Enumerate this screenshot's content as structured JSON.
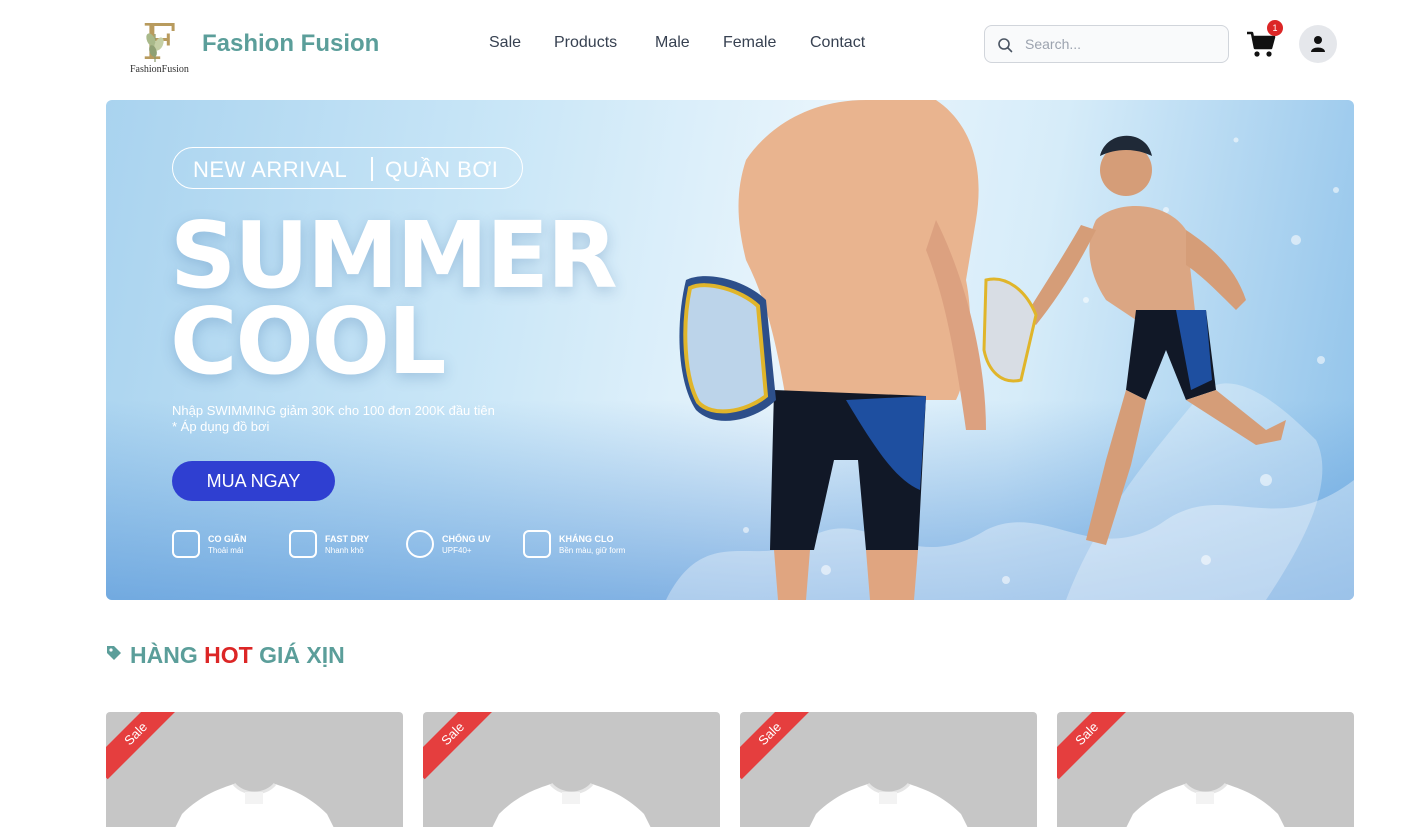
{
  "header": {
    "logo_sub": "FashionFusion",
    "brand": "Fashion Fusion",
    "nav": [
      "Sale",
      "Products",
      "Male",
      "Female",
      "Contact"
    ],
    "search_placeholder": "Search...",
    "cart_count": "1",
    "icons": [
      "search-icon",
      "cart-icon",
      "user-icon"
    ]
  },
  "banner": {
    "pill_left": "NEW ARRIVAL",
    "pill_right": "QUẦN BƠI",
    "headline_1": "SUMMER",
    "headline_2": "COOL",
    "promo_line_1": "Nhập SWIMMING giảm 30K cho 100 đơn 200K đầu tiên",
    "promo_line_2": "* Áp dụng đồ bơi",
    "cta": "MUA NGAY",
    "features": [
      {
        "title": "CO GIÃN",
        "sub": "Thoải mái"
      },
      {
        "title": "FAST DRY",
        "sub": "Nhanh khô"
      },
      {
        "title": "CHỐNG UV",
        "sub": "UPF40+"
      },
      {
        "title": "KHÁNG CLO",
        "sub": "Bền màu, giữ form"
      }
    ]
  },
  "section": {
    "title_pre": "HÀNG ",
    "title_hot": "HOT",
    "title_post": " GIÁ XỊN"
  },
  "products": [
    {
      "badge": "Sale"
    },
    {
      "badge": "Sale"
    },
    {
      "badge": "Sale"
    },
    {
      "badge": "Sale"
    }
  ],
  "colors": {
    "brand": "#5b9e9a",
    "hot": "#dc2626",
    "cta": "#2f3fd1",
    "sale_ribbon": "#e53e3e"
  }
}
